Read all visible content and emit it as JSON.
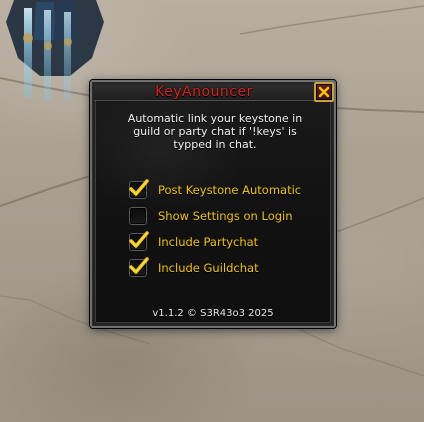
{
  "window": {
    "title": "KeyAnouncer",
    "close_icon": "close-icon",
    "description": "Automatic link your keystone in\nguild or party chat if '!keys' is\ntypped in chat.",
    "options": [
      {
        "label": "Post Keystone Automatic",
        "checked": true
      },
      {
        "label": "Show Settings on Login",
        "checked": false
      },
      {
        "label": "Include Partychat",
        "checked": true
      },
      {
        "label": "Include Guildchat",
        "checked": true
      }
    ],
    "footer": "v1.1.2 © S3R43o3 2025"
  },
  "colors": {
    "title": "#d62121",
    "option_label": "#f0c400",
    "text": "#f2f2f2",
    "close_button_border": "#c9a23a"
  }
}
